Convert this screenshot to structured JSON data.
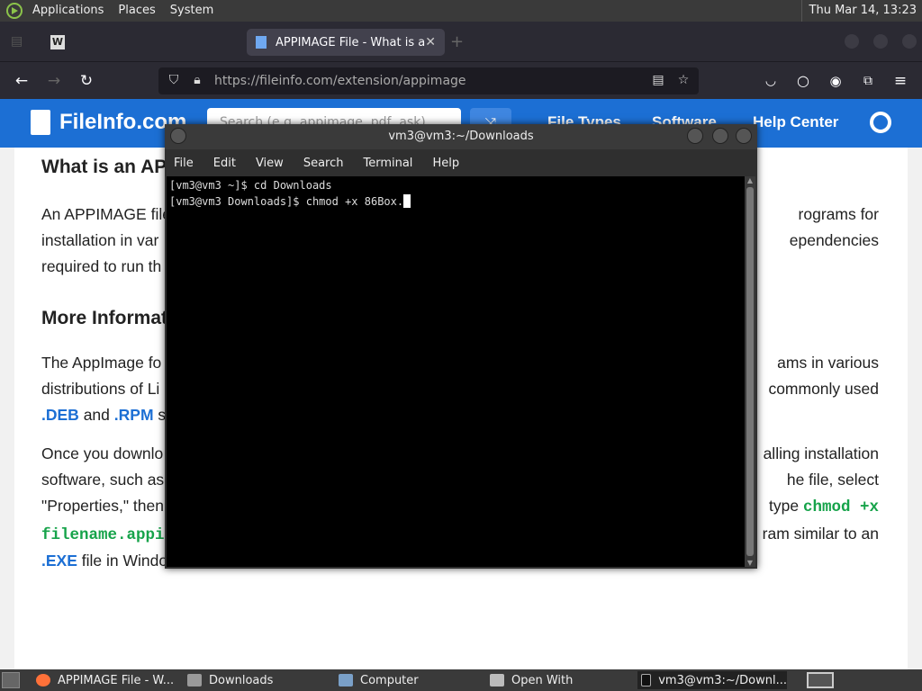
{
  "panel": {
    "menus": [
      "Applications",
      "Places",
      "System"
    ],
    "clock": "Thu Mar 14, 13:23"
  },
  "browser": {
    "tabs": [
      {
        "label": ""
      },
      {
        "label": "APPIMAGE File - What is an"
      }
    ],
    "url_domain": "https://fileinfo.com",
    "url_path": "/extension/appimage"
  },
  "site": {
    "logo": "FileInfo.com",
    "search_placeholder": "Search (e.g. appimage, pdf, ask)",
    "nav": [
      "File Types",
      "Software",
      "Help Center"
    ]
  },
  "article": {
    "heading1": "What is an APPIMAGE file?",
    "para1_line1_left": "An APPIMAGE file",
    "para1_line1_right": "rograms for",
    "para1_line2_left": "installation in var",
    "para1_line2_right": "ependencies",
    "para1_line3_left": "required to run th",
    "heading2": "More Information",
    "para2_line1_left": "The AppImage fo",
    "para2_line1_right": "ams in various",
    "para2_line2_left": "distributions of Li",
    "para2_line2_right": "commonly used",
    "link_deb": ".DEB",
    "and": "and",
    "link_rpm": ".RPM",
    "para2_line3_tail": "so",
    "para3_line1_left": "Once you downlo",
    "para3_line1_right": "alling installation",
    "para3_line2_left": "software, such as",
    "para3_line2_right": "he file, select",
    "para3_line3_left": "\"Properties,\" then",
    "para3_line3_right_text": "type",
    "code1": "chmod +x",
    "code2": "filename.appi",
    "para3_line4_right": "ram similar to an",
    "link_exe": ".EXE",
    "para3_line5_tail": "file in Windo"
  },
  "terminal": {
    "title": "vm3@vm3:~/Downloads",
    "menus": [
      "File",
      "Edit",
      "View",
      "Search",
      "Terminal",
      "Help"
    ],
    "lines": [
      "[vm3@vm3 ~]$ cd Downloads",
      "[vm3@vm3 Downloads]$ chmod +x 86Box."
    ]
  },
  "taskbar": {
    "items": [
      "APPIMAGE File - W...",
      "Downloads",
      "Computer",
      "Open With",
      "vm3@vm3:~/Downl..."
    ]
  }
}
